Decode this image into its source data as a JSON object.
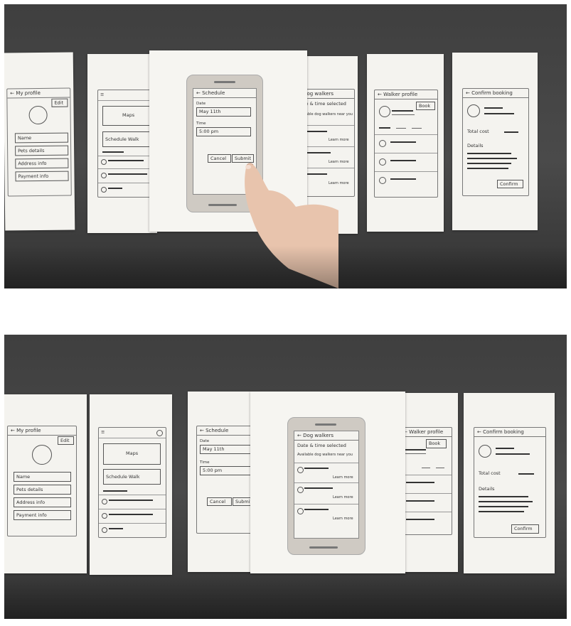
{
  "screens": {
    "my_profile": {
      "title": "← My profile",
      "edit": "Edit",
      "fields": [
        "Name",
        "Pets details",
        "Address info",
        "Payment info"
      ]
    },
    "home": {
      "menu_icon": "hamburger-icon",
      "map_label": "Maps",
      "schedule_walk": "Schedule Walk"
    },
    "schedule": {
      "title": "← Schedule",
      "date_label": "Date",
      "date_value": "May 11th",
      "time_label": "Time",
      "time_value": "5:00 pm",
      "cancel": "Cancel",
      "submit": "Submit"
    },
    "dog_walkers": {
      "title": "← Dog walkers",
      "subtitle": "Date & time selected",
      "available": "Available dog walkers near you",
      "learn_more": "Learn more"
    },
    "walker_profile": {
      "title": "← Walker profile",
      "book": "Book"
    },
    "confirm_booking": {
      "title": "← Confirm booking",
      "total_cost": "Total cost",
      "details": "Details",
      "confirm": "Confirm"
    }
  },
  "colors": {
    "wall": "#454545",
    "paper": "#f4f3ef",
    "phone": "#cfcac3"
  }
}
